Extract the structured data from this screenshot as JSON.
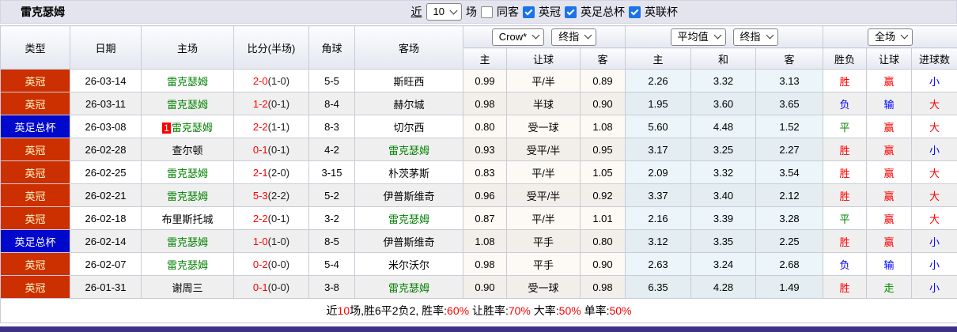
{
  "title": "雷克瑟姆",
  "toolbar": {
    "recent_link": "近",
    "recent_count": "10",
    "unit_label": "场",
    "same_away": {
      "label": "同客",
      "checked": false
    },
    "filters": [
      {
        "label": "英冠",
        "checked": true
      },
      {
        "label": "英足总杯",
        "checked": true
      },
      {
        "label": "英联杯",
        "checked": true
      }
    ]
  },
  "table": {
    "headers": {
      "type": "类型",
      "date": "日期",
      "home": "主场",
      "score": "比分(半场)",
      "corners": "角球",
      "away": "客场",
      "sub": [
        "主",
        "让球",
        "客",
        "主",
        "和",
        "客",
        "胜负",
        "让球",
        "进球数"
      ]
    },
    "selects": {
      "company": "Crow*",
      "company_stage": "终指",
      "euro_source": "平均值",
      "euro_stage": "终指",
      "scope": "全场"
    },
    "rows": [
      {
        "type": "英冠",
        "type_style": "league",
        "date": "26-03-14",
        "home": "雷克瑟姆",
        "home_self": true,
        "home_badge": "",
        "score": "2-0",
        "half": "(1-0)",
        "corners": "5-5",
        "away": "斯旺西",
        "away_self": false,
        "asian": [
          "0.99",
          "平/半",
          "0.89"
        ],
        "euro": [
          "2.26",
          "3.32",
          "3.13"
        ],
        "results": [
          [
            "胜",
            "red"
          ],
          [
            "赢",
            "red"
          ],
          [
            "小",
            "blue"
          ]
        ]
      },
      {
        "type": "英冠",
        "type_style": "league",
        "date": "26-03-11",
        "home": "雷克瑟姆",
        "home_self": true,
        "home_badge": "",
        "score": "1-2",
        "half": "(0-1)",
        "corners": "8-4",
        "away": "赫尔城",
        "away_self": false,
        "asian": [
          "0.98",
          "半球",
          "0.90"
        ],
        "euro": [
          "1.95",
          "3.60",
          "3.65"
        ],
        "results": [
          [
            "负",
            "blue"
          ],
          [
            "输",
            "blue"
          ],
          [
            "大",
            "red"
          ]
        ]
      },
      {
        "type": "英足总杯",
        "type_style": "cup",
        "date": "26-03-08",
        "home": "雷克瑟姆",
        "home_self": true,
        "home_badge": "1",
        "score": "2-2",
        "half": "(1-1)",
        "corners": "8-3",
        "away": "切尔西",
        "away_self": false,
        "asian": [
          "0.80",
          "受一球",
          "1.08"
        ],
        "euro": [
          "5.60",
          "4.48",
          "1.52"
        ],
        "results": [
          [
            "平",
            "green"
          ],
          [
            "赢",
            "red"
          ],
          [
            "大",
            "red"
          ]
        ]
      },
      {
        "type": "英冠",
        "type_style": "league",
        "date": "26-02-28",
        "home": "查尔顿",
        "home_self": false,
        "home_badge": "",
        "score": "0-1",
        "half": "(0-1)",
        "corners": "4-2",
        "away": "雷克瑟姆",
        "away_self": true,
        "asian": [
          "0.93",
          "受平/半",
          "0.95"
        ],
        "euro": [
          "3.17",
          "3.25",
          "2.27"
        ],
        "results": [
          [
            "胜",
            "red"
          ],
          [
            "赢",
            "red"
          ],
          [
            "小",
            "blue"
          ]
        ]
      },
      {
        "type": "英冠",
        "type_style": "league",
        "date": "26-02-25",
        "home": "雷克瑟姆",
        "home_self": true,
        "home_badge": "",
        "score": "2-1",
        "half": "(2-0)",
        "corners": "3-15",
        "away": "朴茨茅斯",
        "away_self": false,
        "asian": [
          "0.83",
          "平/半",
          "1.05"
        ],
        "euro": [
          "2.09",
          "3.32",
          "3.54"
        ],
        "results": [
          [
            "胜",
            "red"
          ],
          [
            "赢",
            "red"
          ],
          [
            "大",
            "red"
          ]
        ]
      },
      {
        "type": "英冠",
        "type_style": "league",
        "date": "26-02-21",
        "home": "雷克瑟姆",
        "home_self": true,
        "home_badge": "",
        "score": "5-3",
        "half": "(2-2)",
        "corners": "5-2",
        "away": "伊普斯维奇",
        "away_self": false,
        "asian": [
          "0.96",
          "受平/半",
          "0.92"
        ],
        "euro": [
          "3.37",
          "3.40",
          "2.12"
        ],
        "results": [
          [
            "胜",
            "red"
          ],
          [
            "赢",
            "red"
          ],
          [
            "大",
            "red"
          ]
        ]
      },
      {
        "type": "英冠",
        "type_style": "league",
        "date": "26-02-18",
        "home": "布里斯托城",
        "home_self": false,
        "home_badge": "",
        "score": "2-2",
        "half": "(0-1)",
        "corners": "3-2",
        "away": "雷克瑟姆",
        "away_self": true,
        "asian": [
          "0.87",
          "平/半",
          "1.01"
        ],
        "euro": [
          "2.16",
          "3.39",
          "3.28"
        ],
        "results": [
          [
            "平",
            "green"
          ],
          [
            "赢",
            "red"
          ],
          [
            "大",
            "red"
          ]
        ]
      },
      {
        "type": "英足总杯",
        "type_style": "cup",
        "date": "26-02-14",
        "home": "雷克瑟姆",
        "home_self": true,
        "home_badge": "",
        "score": "1-0",
        "half": "(1-0)",
        "corners": "8-5",
        "away": "伊普斯维奇",
        "away_self": false,
        "asian": [
          "1.08",
          "平手",
          "0.80"
        ],
        "euro": [
          "3.12",
          "3.35",
          "2.25"
        ],
        "results": [
          [
            "胜",
            "red"
          ],
          [
            "赢",
            "red"
          ],
          [
            "小",
            "blue"
          ]
        ]
      },
      {
        "type": "英冠",
        "type_style": "league",
        "date": "26-02-07",
        "home": "雷克瑟姆",
        "home_self": true,
        "home_badge": "",
        "score": "0-2",
        "half": "(0-0)",
        "corners": "5-4",
        "away": "米尔沃尔",
        "away_self": false,
        "asian": [
          "0.98",
          "平手",
          "0.90"
        ],
        "euro": [
          "2.63",
          "3.24",
          "2.68"
        ],
        "results": [
          [
            "负",
            "blue"
          ],
          [
            "输",
            "blue"
          ],
          [
            "小",
            "blue"
          ]
        ]
      },
      {
        "type": "英冠",
        "type_style": "league",
        "date": "26-01-31",
        "home": "谢周三",
        "home_self": false,
        "home_badge": "",
        "score": "0-1",
        "half": "(0-0)",
        "corners": "3-8",
        "away": "雷克瑟姆",
        "away_self": true,
        "asian": [
          "0.90",
          "受一球",
          "0.98"
        ],
        "euro": [
          "6.35",
          "4.28",
          "1.49"
        ],
        "results": [
          [
            "胜",
            "red"
          ],
          [
            "走",
            "green"
          ],
          [
            "小",
            "blue"
          ]
        ]
      }
    ]
  },
  "summary": {
    "segments": [
      {
        "text": "近",
        "color": "black"
      },
      {
        "text": "10",
        "color": "red"
      },
      {
        "text": "场,胜6平2负2, 胜率:",
        "color": "black"
      },
      {
        "text": "60%",
        "color": "red"
      },
      {
        "text": " 让胜率:",
        "color": "black"
      },
      {
        "text": "70%",
        "color": "red"
      },
      {
        "text": " 大率:",
        "color": "black"
      },
      {
        "text": "50%",
        "color": "red"
      },
      {
        "text": " 单率:",
        "color": "black"
      },
      {
        "text": "50%",
        "color": "red"
      }
    ]
  },
  "colors": {
    "league_badge": "#cc2f00",
    "cup_badge": "#0008cc",
    "self_team": "#008000",
    "win": "#ff0000",
    "draw": "#008800",
    "loss": "#0000ff",
    "accent_bar": "#3b3188"
  }
}
